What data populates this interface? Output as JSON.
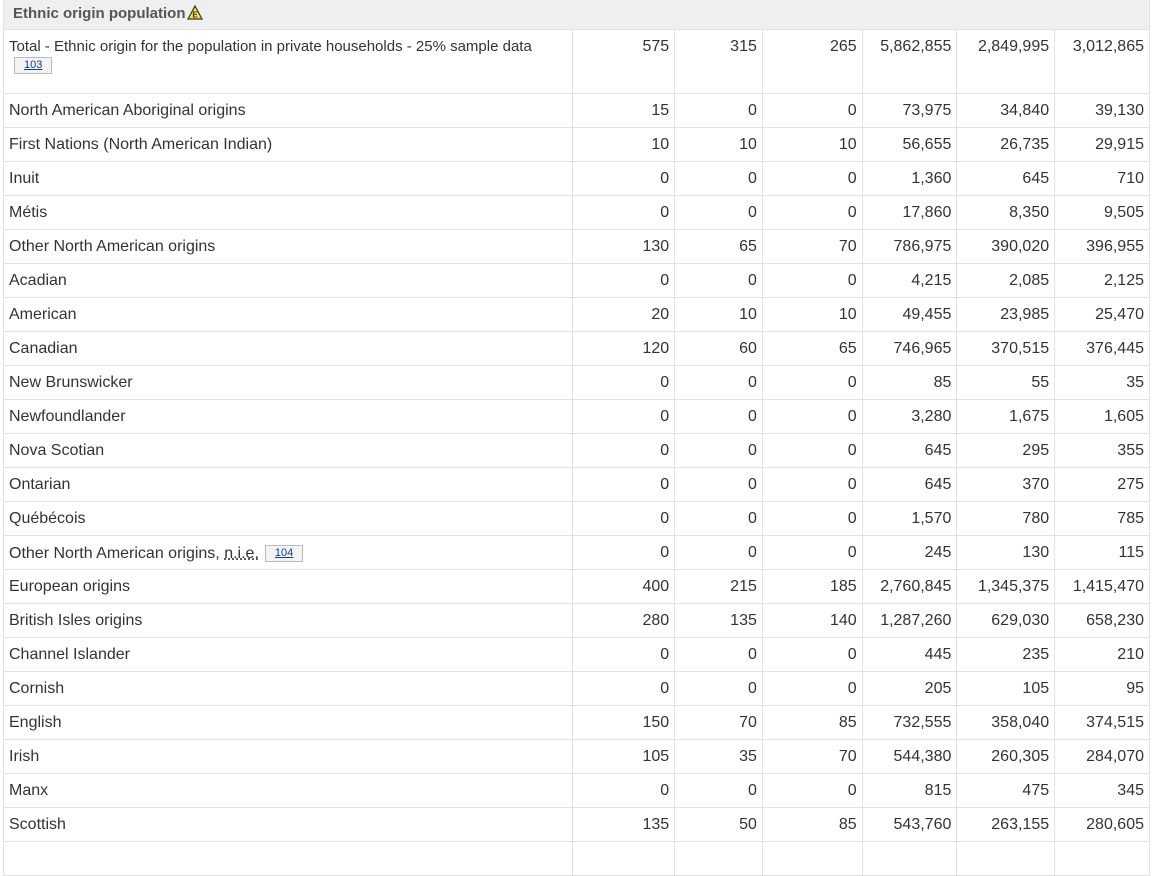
{
  "section_title": "Ethnic origin population",
  "total": {
    "label": "Total - Ethnic origin for the population in private households - 25% sample data",
    "ref": "103",
    "values": [
      "575",
      "315",
      "265",
      "5,862,855",
      "2,849,995",
      "3,012,865"
    ]
  },
  "rows": [
    {
      "label": "North American Aboriginal origins",
      "level": 1,
      "values": [
        "15",
        "0",
        "0",
        "73,975",
        "34,840",
        "39,130"
      ]
    },
    {
      "label": "First Nations (North American Indian)",
      "level": 2,
      "values": [
        "10",
        "10",
        "10",
        "56,655",
        "26,735",
        "29,915"
      ]
    },
    {
      "label": "Inuit",
      "level": 2,
      "values": [
        "0",
        "0",
        "0",
        "1,360",
        "645",
        "710"
      ]
    },
    {
      "label": "Métis",
      "level": 2,
      "values": [
        "0",
        "0",
        "0",
        "17,860",
        "8,350",
        "9,505"
      ]
    },
    {
      "label": "Other North American origins",
      "level": 1,
      "values": [
        "130",
        "65",
        "70",
        "786,975",
        "390,020",
        "396,955"
      ]
    },
    {
      "label": "Acadian",
      "level": 2,
      "values": [
        "0",
        "0",
        "0",
        "4,215",
        "2,085",
        "2,125"
      ]
    },
    {
      "label": "American",
      "level": 2,
      "values": [
        "20",
        "10",
        "10",
        "49,455",
        "23,985",
        "25,470"
      ]
    },
    {
      "label": "Canadian",
      "level": 2,
      "values": [
        "120",
        "60",
        "65",
        "746,965",
        "370,515",
        "376,445"
      ]
    },
    {
      "label": "New Brunswicker",
      "level": 2,
      "values": [
        "0",
        "0",
        "0",
        "85",
        "55",
        "35"
      ]
    },
    {
      "label": "Newfoundlander",
      "level": 2,
      "values": [
        "0",
        "0",
        "0",
        "3,280",
        "1,675",
        "1,605"
      ]
    },
    {
      "label": "Nova Scotian",
      "level": 2,
      "values": [
        "0",
        "0",
        "0",
        "645",
        "295",
        "355"
      ]
    },
    {
      "label": "Ontarian",
      "level": 2,
      "values": [
        "0",
        "0",
        "0",
        "645",
        "370",
        "275"
      ]
    },
    {
      "label": "Québécois",
      "level": 2,
      "values": [
        "0",
        "0",
        "0",
        "1,570",
        "780",
        "785"
      ]
    },
    {
      "label": "Other North American origins, ",
      "abbr": "n.i.e.",
      "ref": "104",
      "level": 2,
      "values": [
        "0",
        "0",
        "0",
        "245",
        "130",
        "115"
      ]
    },
    {
      "label": "European origins",
      "level": 1,
      "values": [
        "400",
        "215",
        "185",
        "2,760,845",
        "1,345,375",
        "1,415,470"
      ]
    },
    {
      "label": "British Isles origins",
      "level": 2,
      "values": [
        "280",
        "135",
        "140",
        "1,287,260",
        "629,030",
        "658,230"
      ]
    },
    {
      "label": "Channel Islander",
      "level": 3,
      "values": [
        "0",
        "0",
        "0",
        "445",
        "235",
        "210"
      ]
    },
    {
      "label": "Cornish",
      "level": 3,
      "values": [
        "0",
        "0",
        "0",
        "205",
        "105",
        "95"
      ]
    },
    {
      "label": "English",
      "level": 3,
      "values": [
        "150",
        "70",
        "85",
        "732,555",
        "358,040",
        "374,515"
      ]
    },
    {
      "label": "Irish",
      "level": 3,
      "values": [
        "105",
        "35",
        "70",
        "544,380",
        "260,305",
        "284,070"
      ]
    },
    {
      "label": "Manx",
      "level": 3,
      "values": [
        "0",
        "0",
        "0",
        "815",
        "475",
        "345"
      ]
    },
    {
      "label": "Scottish",
      "level": 3,
      "values": [
        "135",
        "50",
        "85",
        "543,760",
        "263,155",
        "280,605"
      ]
    },
    {
      "label": "",
      "level": 3,
      "values": [
        "",
        "",
        "",
        "",
        "",
        ""
      ]
    }
  ]
}
